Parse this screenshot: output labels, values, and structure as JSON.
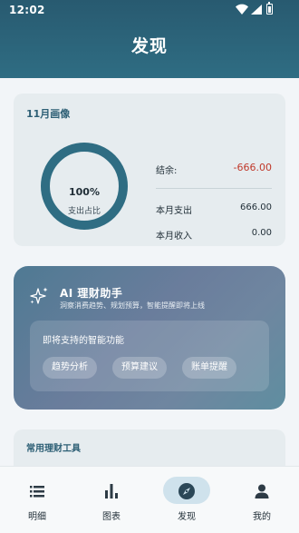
{
  "status_bar": {
    "time": "12:02"
  },
  "header": {
    "title": "发现"
  },
  "profile_card": {
    "title": "11月画像",
    "ring_percent": "100%",
    "ring_fraction": 1.0,
    "ring_label": "支出占比",
    "balance_label": "结余:",
    "balance_value": "-666.00",
    "expense_label": "本月支出",
    "expense_value": "666.00",
    "income_label": "本月收入",
    "income_value": "0.00",
    "ring_color": "#2f6d83"
  },
  "ai_card": {
    "title": "AI 理财助手",
    "subtitle": "洞察消费趋势、规划预算，智能提醒即将上线",
    "inner_title": "即将支持的智能功能",
    "chips": [
      "趋势分析",
      "预算建议",
      "账单提醒"
    ]
  },
  "tools_card": {
    "title": "常用理财工具"
  },
  "tabbar": {
    "tabs": [
      {
        "label": "明细",
        "icon": "list-icon"
      },
      {
        "label": "图表",
        "icon": "bar-chart-icon"
      },
      {
        "label": "发现",
        "icon": "compass-icon",
        "active": true
      },
      {
        "label": "我的",
        "icon": "person-icon"
      }
    ]
  },
  "colors": {
    "header": "#285a70",
    "accent": "#2f6d83",
    "negative": "#c0392b"
  }
}
